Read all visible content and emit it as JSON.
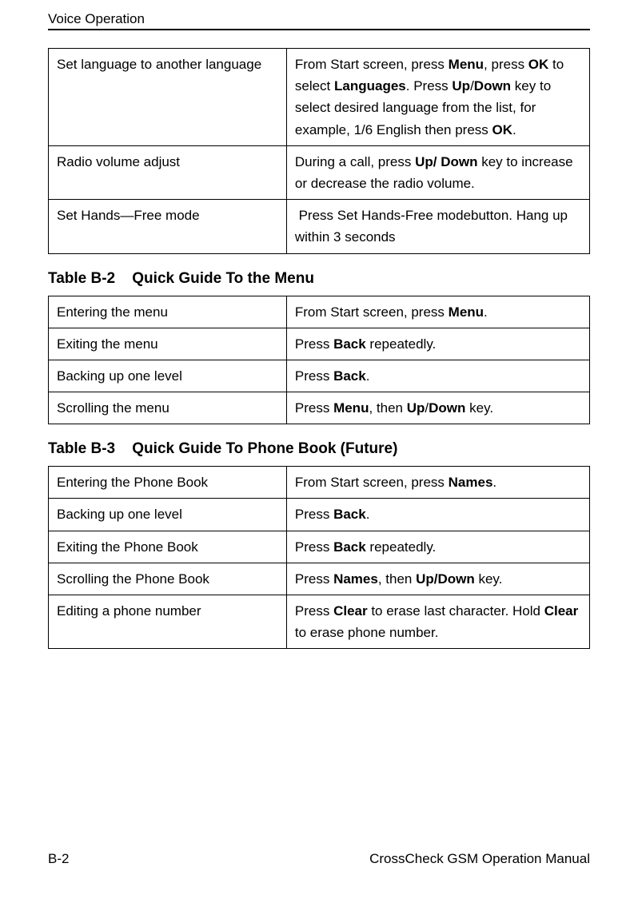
{
  "header": {
    "section_title": "Voice Operation"
  },
  "table1_rows": [
    {
      "left": "Set language to another language",
      "right": "From Start screen, press <b>Menu</b>, press <b>OK</b> to select <b>Languages</b>. Press <b>Up</b>/<b>Down</b> key to select desired language from the list, for example, 1/6 English then press <b>OK</b>."
    },
    {
      "left": "Radio volume adjust",
      "right": "During a call, press <b>Up/ Down</b> key to increase or decrease the radio volume."
    },
    {
      "left": "Set Hands—Free mode",
      "right": "&nbsp;Press Set Hands-Free modebutton. Hang up within 3 seconds"
    }
  ],
  "caption2": {
    "num": "Table B-2",
    "title": "Quick Guide To the Menu"
  },
  "table2_rows": [
    {
      "left": "Entering the menu",
      "right": "From Start screen, press <b>Menu</b>."
    },
    {
      "left": "Exiting the menu",
      "right": "Press <b>Back</b> repeatedly."
    },
    {
      "left": "Backing up one level",
      "right": "Press <b>Back</b>."
    },
    {
      "left": "Scrolling the menu",
      "right": "Press <b>Menu</b>, then <b>Up</b>/<b>Down</b> key."
    }
  ],
  "caption3": {
    "num": "Table B-3",
    "title": "Quick Guide To Phone Book (Future)"
  },
  "table3_rows": [
    {
      "left": "Entering the Phone Book",
      "right": "From Start screen, press <b>Names</b>."
    },
    {
      "left": "Backing up one level",
      "right": "Press <b>Back</b>."
    },
    {
      "left": "Exiting the Phone Book",
      "right": "Press <b>Back</b> repeatedly."
    },
    {
      "left": "Scrolling the Phone Book",
      "right": "Press <b>Names</b>, then <b>Up/Down</b> key."
    },
    {
      "left": "Editing a phone number",
      "right": "Press <b>Clear</b> to erase last character. Hold <b>Clear</b> to erase phone number."
    }
  ],
  "footer": {
    "page": "B-2",
    "doc": "CrossCheck GSM Operation Manual"
  }
}
